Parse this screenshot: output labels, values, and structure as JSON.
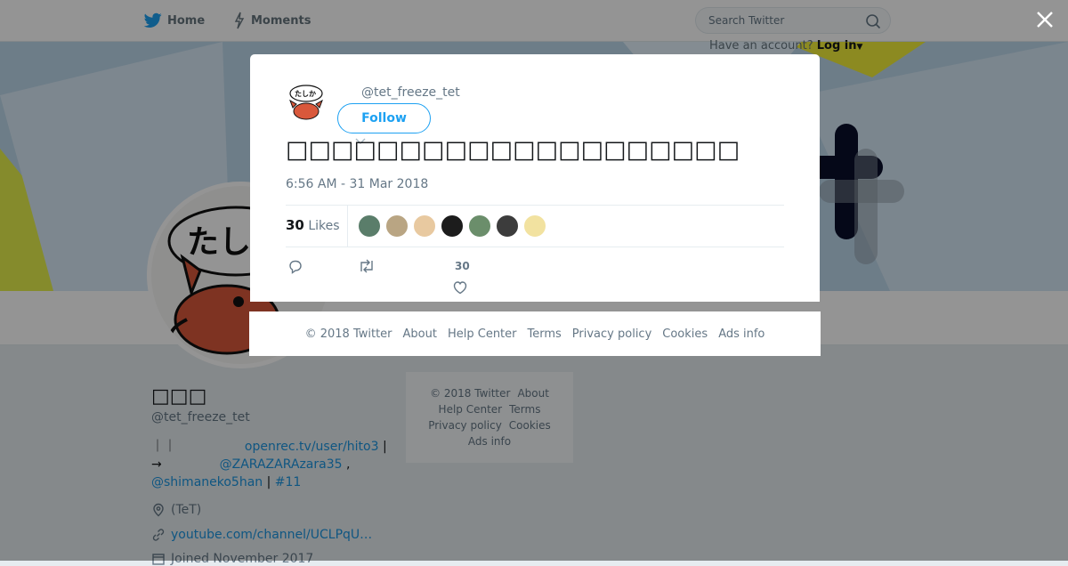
{
  "nav": {
    "home_label": "Home",
    "moments_label": "Moments",
    "search_placeholder": "Search Twitter",
    "account_prompt": "Have an account?",
    "login_label": "Log in"
  },
  "profile": {
    "name": "□□□",
    "handle": "@tet_freeze_tet",
    "bio_line1_prefix": "｜｜",
    "bio_link1": "openrec.tv/user/hito3",
    "bio_line1_suffix": "|",
    "bio_arrow": "→",
    "bio_link2": "@ZARAZARAzara35",
    "bio_comma": ",",
    "bio_link3": "@shimaneko5han",
    "bio_sep": "|",
    "bio_link4": "#11",
    "location": "(TeT)",
    "website": "youtube.com/channel/UCLPqU…",
    "joined": "Joined November 2017"
  },
  "side_footer": {
    "copyright": "© 2018 Twitter",
    "about": "About",
    "help": "Help Center",
    "terms": "Terms",
    "privacy": "Privacy policy",
    "cookies": "Cookies",
    "ads": "Ads info"
  },
  "tweet": {
    "handle": "@tet_freeze_tet",
    "follow_label": "Follow",
    "text": "□□□□□□□□□□□□□□□□□□□□",
    "timestamp": "6:56 AM - 31 Mar 2018",
    "likes_count": "30",
    "likes_label": "Likes",
    "like_action_count": "30",
    "liker_colors": [
      "#5a7d6a",
      "#b9a583",
      "#e8c9a0",
      "#1c1c1c",
      "#6b8e6b",
      "#3c3c3c",
      "#f2e2a0"
    ]
  },
  "modal_footer": {
    "copyright": "© 2018 Twitter",
    "about": "About",
    "help": "Help Center",
    "terms": "Terms",
    "privacy": "Privacy policy",
    "cookies": "Cookies",
    "ads": "Ads info"
  },
  "colors": {
    "brand": "#1da1f2",
    "link": "#1b95e0",
    "text_secondary": "#657786"
  }
}
